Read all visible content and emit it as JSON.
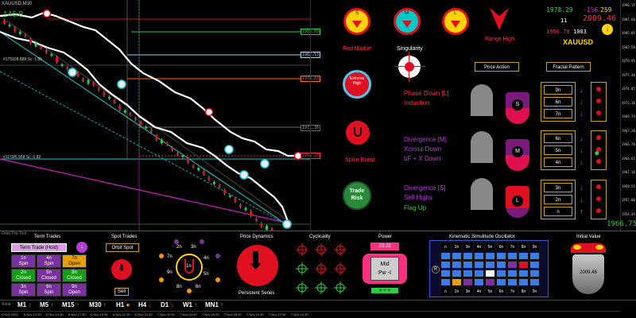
{
  "chart": {
    "symbol": "XAUUSD,M30",
    "top_value": "146.8",
    "tiny_label": "Orbit The Tool v1.1",
    "left_label_1": "#175928,888 Sc: 1.85",
    "left_label_2": "#1179/6,958 Sc: 0.82",
    "level_labels": [
      "1985.93",
      "1982.53",
      "1978.03",
      "1971.35",
      "1968.25"
    ],
    "price_scale": [
      "1990.15",
      "1987.60",
      "1985.05",
      "1982.50",
      "1979.95",
      "1977.40",
      "1974.85",
      "1972.30",
      "1969.75",
      "1967.20",
      "1966.70",
      "1964.65",
      "1962.10",
      "1959.55",
      "1957.00",
      "1954.45"
    ],
    "current_price": "1966.75",
    "time_labels": [
      "6 Nov 2023",
      "6 Nov 13:30",
      "6 Nov 15:30",
      "6 Nov 17:30",
      "6 Nov 19:30",
      "6 Nov 21:30",
      "6 Nov 23:30",
      "7 Nov 02:00",
      "7 Nov 04:00",
      "7 Nov 06:00",
      "7 Nov 08:30",
      "7 Nov 10:30",
      "7 Nov 12:30",
      "7 Nov 14:30"
    ],
    "timeframes": [
      "M1",
      "M5",
      "M15",
      "M30",
      "H1",
      "H4",
      "D1",
      "W1",
      "MN1"
    ],
    "tf_colors": [
      "#2ecc40",
      "#2ecc40",
      "#2ecc40",
      "#2ecc40",
      "#ff9800",
      "#ff3030",
      "#ff3030",
      "#2ecc40",
      "#2ecc40"
    ],
    "footer_label": "Orbit The Tool",
    "bottom_left_label": "Solar"
  },
  "right_panel": {
    "circles": [
      {
        "letter": "S",
        "color": "#ffd400"
      },
      {
        "letter": "M",
        "color": "#00c8c8"
      },
      {
        "letter": "L",
        "color": "#ffd400"
      }
    ],
    "range_high": "Range High",
    "red_market": "Red Market",
    "singularity": "Singularity",
    "extreme_high": "Extreme\nHigh",
    "spike_event": "Spike Event",
    "trade_risk": "Trade\nRisk",
    "phase_down": "Phase Down [L]\nInduction",
    "divergence_m": "Divergence [M]\nXcross Down\nbF + X Down",
    "divergence_s": "Divergence [S]\nSell Highs",
    "flag_up": "Flag Up",
    "stats": {
      "a": "1978.29",
      "b": "-156",
      "c": "259",
      "d": "2009.46",
      "e": "11",
      "f": "1956.78",
      "g": "1003",
      "symbol": "XAUUSD"
    },
    "price_action": "Price Action",
    "fractal_pattern": "Fractal Pattern",
    "tf_rows": [
      [
        "9n",
        "6n",
        "7n"
      ],
      [
        "6n",
        "5n",
        "4n"
      ],
      [
        "3n",
        "2n",
        "n"
      ]
    ],
    "pillar_letters": [
      "S",
      "M",
      "L"
    ]
  },
  "bottom": {
    "term_trades_title": "Term Trades",
    "term_trade_hold": "Term Trade (Hold)",
    "trade_cells": [
      [
        "1n\nSpin",
        "4n\nSpin",
        "7n\nOpen"
      ],
      [
        "2n\nClosed",
        "5n\nClosed",
        "8n\nClosed"
      ],
      [
        "3n\nSpin",
        "6n\nSpin",
        "9n\nOpen"
      ]
    ],
    "trade_colors": [
      [
        "#7b2fa0",
        "#7b2fa0",
        "#e8a000"
      ],
      [
        "#12a012",
        "#7b2fa0",
        "#12a012"
      ],
      [
        "#7b2fa0",
        "#7b2fa0",
        "#7b2fa0"
      ]
    ],
    "spot_trades_title": "Spot Trades",
    "orbit_spot": "Orbit Spot",
    "sell": "Sell",
    "orbit_labels": [
      "2n",
      "3n",
      "4n",
      "9n",
      "1n",
      "5n",
      "8n",
      "7n",
      "6n"
    ],
    "price_dynamics_title": "Price Dynamics",
    "persistent_series": "Persistent Series",
    "cyclicality_title": "Cyclicality",
    "power_title": "Power",
    "power_time": "23:23",
    "power_label": "Mid\nPw -I",
    "power_bottom": "+ + +",
    "kinematic_title": "Kinematic Simulitude Oscillator",
    "kso_headers": [
      "n",
      "2n",
      "3n",
      "4n",
      "5n",
      "6n",
      "7n",
      "8n",
      "9n"
    ],
    "kso_left": "R",
    "initial_value_title": "Initial Value",
    "initial_value": "2009.46"
  }
}
